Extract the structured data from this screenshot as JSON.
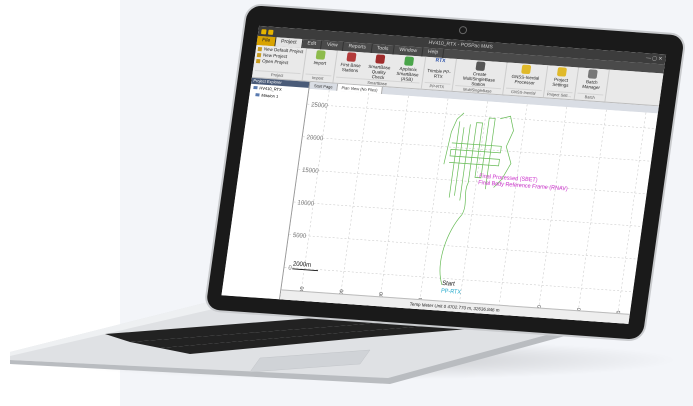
{
  "window": {
    "title": "HV410_RTX - POSPac MMS"
  },
  "menus": [
    "File",
    "Project",
    "Edit",
    "View",
    "Reports",
    "Tools",
    "Window",
    "Help"
  ],
  "ribbon": {
    "project_items": [
      "New Default Project",
      "New Project",
      "Open Project"
    ],
    "groups": [
      {
        "label": "Project",
        "buttons": []
      },
      {
        "label": "Import",
        "buttons": [
          "Import"
        ]
      },
      {
        "label": "SmartBase",
        "buttons": [
          "First Base Stations",
          "SmartBase Quality Check",
          "Applanix SmartBase (ASB)"
        ]
      },
      {
        "label": "PP-RTX",
        "buttons": [
          "Trimble PP-RTX"
        ]
      },
      {
        "label": "MultiSingleBase",
        "buttons": [
          "Create MultiSingleBase Station"
        ]
      },
      {
        "label": "GNSS-Inertial",
        "buttons": [
          "GNSS-Inertial Processor"
        ]
      },
      {
        "label": "Project Sett...",
        "buttons": [
          "Project Settings"
        ]
      },
      {
        "label": "Batch",
        "buttons": [
          "Batch Manager"
        ]
      }
    ],
    "pprtx_badge": "RTX"
  },
  "explorer": {
    "header": "Project Explorer",
    "items": [
      "HV410_RTX",
      "Mission 1"
    ]
  },
  "tabs": [
    "Start Page",
    "Plan View (No Files)"
  ],
  "plot": {
    "y_ticks": [
      "25000",
      "20000",
      "15000",
      "10000",
      "5000",
      "0"
    ],
    "x_ticks": [
      "-20000",
      "-15000",
      "-10000",
      "-5000",
      "0",
      "5000",
      "10000",
      "15000",
      "20000"
    ],
    "scale_label": "2000m",
    "frame_label": "Final Processed (SBET)",
    "frame_label2": "Final Body Reference Frame (RNAV)",
    "start_label": "Start",
    "start_label2": "PP-RTX",
    "frame_color": "#cc33cc",
    "track_color": "#66bb55",
    "start_color": "#22aacc"
  },
  "status": {
    "text": "Temp  Meter  Unit    0   4702.770 m, 32636.846 m"
  }
}
